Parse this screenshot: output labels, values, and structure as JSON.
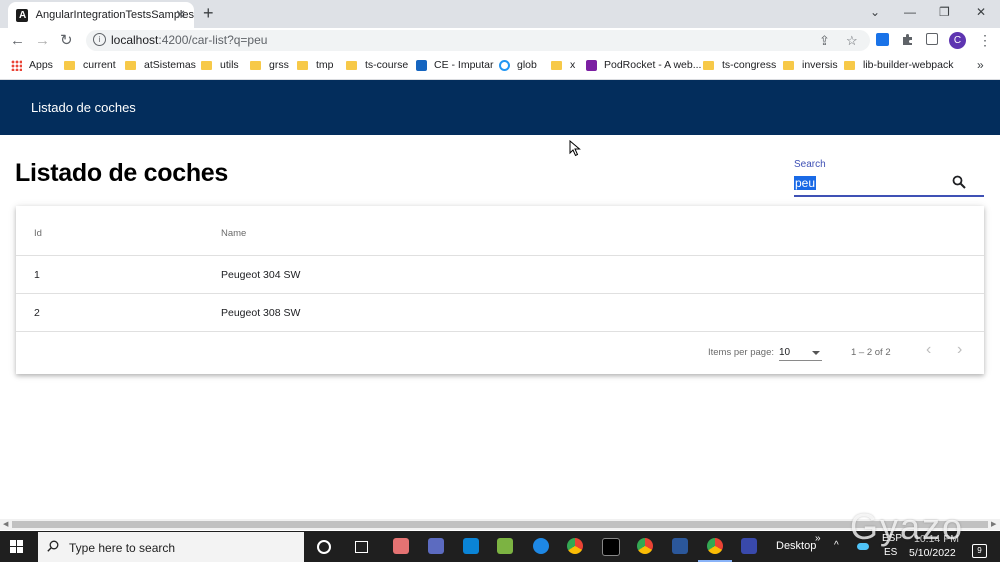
{
  "browser": {
    "tab_title": "AngularIntegrationTestsSamples",
    "tab_close": "✕",
    "new_tab": "+",
    "window_controls": {
      "minimize": "—",
      "maximize": "❐",
      "close": "✕",
      "tabsearch": "⌄"
    },
    "nav": {
      "back": "←",
      "forward": "→",
      "reload": "↻"
    },
    "url_host": "localhost",
    "url_path": ":4200/car-list?q=peu",
    "avatar_letter": "C",
    "menu": "⋮"
  },
  "bookmarks": {
    "items": [
      {
        "label": "Apps",
        "icon": "apps-grid-icon"
      },
      {
        "label": "current",
        "icon": "folder-icon"
      },
      {
        "label": "atSistemas",
        "icon": "folder-icon"
      },
      {
        "label": "utils",
        "icon": "folder-icon"
      },
      {
        "label": "grss",
        "icon": "folder-icon"
      },
      {
        "label": "tmp",
        "icon": "folder-icon"
      },
      {
        "label": "ts-course",
        "icon": "folder-icon"
      },
      {
        "label": "CE - Imputar",
        "icon": "ce-icon"
      },
      {
        "label": "glob",
        "icon": "glob-icon"
      },
      {
        "label": "x",
        "icon": "folder-icon"
      },
      {
        "label": "PodRocket - A web...",
        "icon": "podrocket-icon"
      },
      {
        "label": "ts-congress",
        "icon": "folder-icon"
      },
      {
        "label": "inversis",
        "icon": "folder-icon"
      },
      {
        "label": "lib-builder-webpack",
        "icon": "folder-icon"
      }
    ],
    "more": "»"
  },
  "app": {
    "header_title": "Listado de coches",
    "page_title": "Listado de coches",
    "search": {
      "label": "Search",
      "value": "peu"
    },
    "table": {
      "columns": [
        "Id",
        "Name"
      ],
      "rows": [
        {
          "id": "1",
          "name": "Peugeot 304 SW"
        },
        {
          "id": "2",
          "name": "Peugeot 308 SW"
        }
      ]
    },
    "paginator": {
      "items_per_page_label": "Items per page:",
      "page_size": "10",
      "range": "1 – 2 of 2",
      "prev": "‹",
      "next": "›"
    }
  },
  "taskbar": {
    "search_placeholder": "Type here to search",
    "desktop_label": "Desktop",
    "desktop_chevron": "»",
    "tray_chevron": "^",
    "lang": "ESP",
    "lang2": "ES",
    "time": "10:14 PM",
    "date": "5/10/2022",
    "notifications": "9"
  },
  "watermark": "Gyazo",
  "colors": {
    "app_header": "#032d5c",
    "accent": "#3f51b5",
    "selection": "#1a6ae6"
  }
}
